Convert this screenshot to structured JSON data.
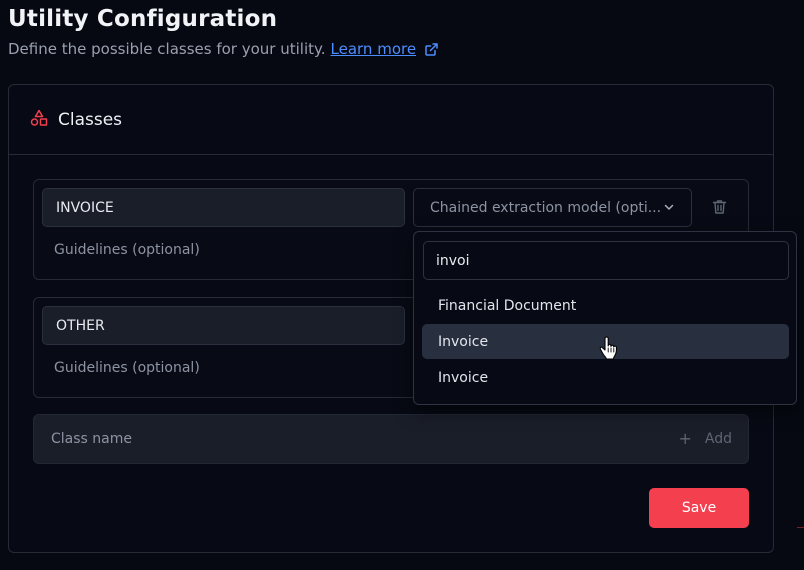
{
  "page": {
    "title": "Utility Configuration",
    "subtitle": "Define the possible classes for your utility.",
    "learn_more": "Learn more"
  },
  "card": {
    "title": "Classes",
    "icon": "shapes-icon"
  },
  "classes": [
    {
      "name": "INVOICE",
      "guidelines_placeholder": "Guidelines (optional)",
      "model_placeholder": "Chained extraction model (opti..."
    },
    {
      "name": "OTHER",
      "guidelines_placeholder": "Guidelines (optional)"
    }
  ],
  "add_class": {
    "placeholder": "Class name",
    "add_label": "Add"
  },
  "save_label": "Save",
  "dropdown": {
    "search_value": "invoi",
    "options": [
      "Financial Document",
      "Invoice",
      "Invoice"
    ],
    "hovered_index": 1
  },
  "colors": {
    "accent": "#f43f4e",
    "link": "#4c8dff",
    "background": "#060912"
  }
}
